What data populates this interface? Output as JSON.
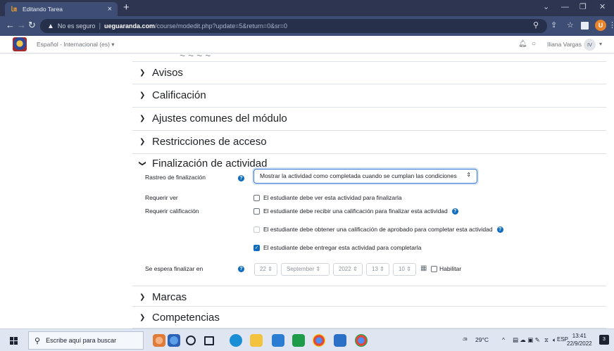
{
  "browser": {
    "tab_title": "Editando Tarea",
    "tab_favicon": "moodle-favicon-icon",
    "new_tab": "+",
    "security_label": "No es seguro",
    "url_domain": "ueguaranda.com",
    "url_path": "/course/modedit.php?update=5&return=0&sr=0",
    "profile_initial": "U"
  },
  "navbar": {
    "language": "Español - Internacional (es) ▾",
    "user_name": "Iliana Vargas",
    "user_initials": "IV"
  },
  "sections": [
    {
      "title": "Avisos",
      "expanded": false
    },
    {
      "title": "Calificación",
      "expanded": false
    },
    {
      "title": "Ajustes comunes del módulo",
      "expanded": false
    },
    {
      "title": "Restricciones de acceso",
      "expanded": false
    },
    {
      "title": "Finalización de actividad",
      "expanded": true
    },
    {
      "title": "Marcas",
      "expanded": false
    },
    {
      "title": "Competencias",
      "expanded": false
    }
  ],
  "completion": {
    "tracking_label": "Rastreo de finalización",
    "tracking_value": "Mostrar la actividad como completada cuando se cumplan las condiciones",
    "require_view_label": "Requerir ver",
    "require_view_text": "El estudiante debe ver esta actividad para finalizarla",
    "require_view_checked": false,
    "require_grade_label": "Requerir calificación",
    "require_grade_text": "El estudiante debe recibir una calificación para finalizar esta actividad",
    "require_grade_checked": false,
    "pass_grade_text": "El estudiante debe obtener una calificación de aprobado para completar esta actividad",
    "pass_grade_checked": false,
    "submit_text": "El estudiante debe entregar esta actividad para completarla",
    "submit_checked": true,
    "expected_label": "Se espera finalizar en",
    "expected_day": "22",
    "expected_month": "September",
    "expected_year": "2022",
    "expected_hour": "13",
    "expected_minute": "10",
    "enable_label": "Habilitar",
    "enable_checked": false
  },
  "taskbar": {
    "search_placeholder": "Escribe aquí para buscar",
    "weather": "29°C",
    "language": "ESP",
    "time": "13:41",
    "date": "22/9/2022",
    "notifications": "3"
  },
  "colors": {
    "browser_frame": "#3d4d73",
    "accent": "#0f6cbf",
    "taskbar": "#dfe6f2"
  }
}
